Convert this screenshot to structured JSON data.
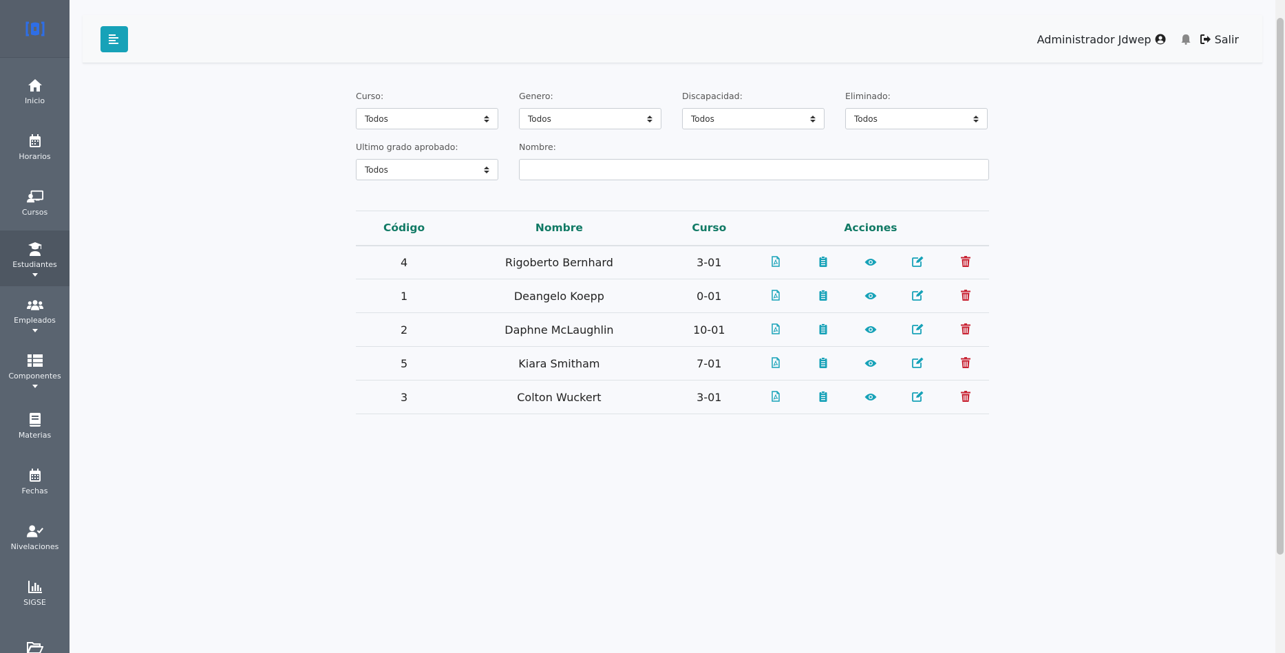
{
  "sidebar": {
    "items": [
      {
        "label": "Inicio",
        "icon": "home-icon"
      },
      {
        "label": "Horarios",
        "icon": "calendar-icon"
      },
      {
        "label": "Cursos",
        "icon": "chalkboard-teacher-icon"
      },
      {
        "label": "Estudiantes",
        "icon": "graduate-icon",
        "active": true,
        "caret": true
      },
      {
        "label": "Empleados",
        "icon": "users-icon",
        "caret": true
      },
      {
        "label": "Componentes",
        "icon": "list-icon",
        "caret": true
      },
      {
        "label": "Materias",
        "icon": "book-icon"
      },
      {
        "label": "Fechas",
        "icon": "calendar-alt-icon"
      },
      {
        "label": "Nivelaciones",
        "icon": "user-check-icon"
      },
      {
        "label": "SIGSE",
        "icon": "chart-bar-icon"
      },
      {
        "label": "",
        "icon": "folder-open-icon"
      }
    ]
  },
  "topbar": {
    "user_name": "Administrador Jdwep",
    "logout_label": "Salir"
  },
  "filters": {
    "curso_label": "Curso:",
    "curso_value": "Todos",
    "genero_label": "Genero:",
    "genero_value": "Todos",
    "discapacidad_label": "Discapacidad:",
    "discapacidad_value": "Todos",
    "eliminado_label": "Eliminado:",
    "eliminado_value": "Todos",
    "ultimo_grado_label": "Ultimo grado aprobado:",
    "ultimo_grado_value": "Todos",
    "nombre_label": "Nombre:",
    "nombre_value": ""
  },
  "table": {
    "headers": {
      "codigo": "Código",
      "nombre": "Nombre",
      "curso": "Curso",
      "acciones": "Acciones"
    },
    "rows": [
      {
        "codigo": "4",
        "nombre": "Rigoberto Bernhard",
        "curso": "3-01"
      },
      {
        "codigo": "1",
        "nombre": "Deangelo Koepp",
        "curso": "0-01"
      },
      {
        "codigo": "2",
        "nombre": "Daphne McLaughlin",
        "curso": "10-01"
      },
      {
        "codigo": "5",
        "nombre": "Kiara Smitham",
        "curso": "7-01"
      },
      {
        "codigo": "3",
        "nombre": "Colton Wuckert",
        "curso": "3-01"
      }
    ]
  },
  "colors": {
    "accent": "#17a2b8",
    "header_text": "#117a65",
    "danger": "#c82333",
    "sidebar": "#5a6470"
  }
}
